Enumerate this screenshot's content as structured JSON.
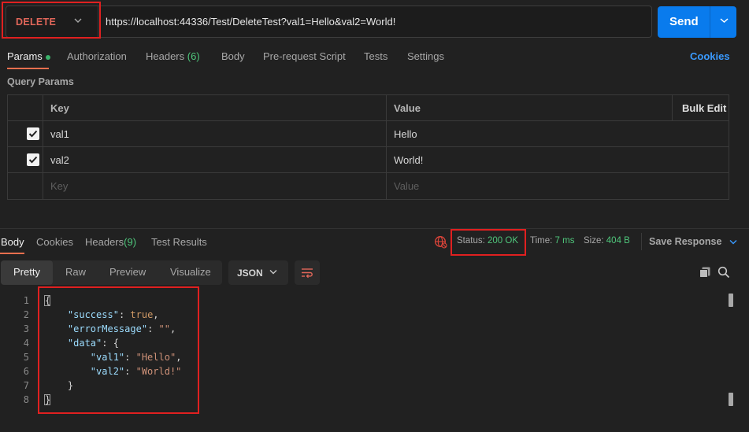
{
  "request": {
    "method": "DELETE",
    "url": "https://localhost:44336/Test/DeleteTest?val1=Hello&val2=World!",
    "send_label": "Send"
  },
  "request_tabs": {
    "params": "Params",
    "authorization": "Authorization",
    "headers": "Headers",
    "headers_count": "(6)",
    "body": "Body",
    "prerequest": "Pre-request Script",
    "tests": "Tests",
    "settings": "Settings",
    "cookies": "Cookies"
  },
  "query_params": {
    "title": "Query Params",
    "headers": {
      "key": "Key",
      "value": "Value",
      "bulk_edit": "Bulk Edit"
    },
    "rows": [
      {
        "key": "val1",
        "value": "Hello",
        "checked": true
      },
      {
        "key": "val2",
        "value": "World!",
        "checked": true
      }
    ],
    "placeholder": {
      "key": "Key",
      "value": "Value"
    }
  },
  "response_tabs": {
    "body": "Body",
    "cookies": "Cookies",
    "headers": "Headers",
    "headers_count": "(9)",
    "test_results": "Test Results"
  },
  "response_meta": {
    "status_label": "Status:",
    "status_value": "200 OK",
    "time_label": "Time:",
    "time_value": "7 ms",
    "size_label": "Size:",
    "size_value": "404 B",
    "save_response": "Save Response"
  },
  "response_view": {
    "modes": [
      "Pretty",
      "Raw",
      "Preview",
      "Visualize"
    ],
    "active_mode": "Pretty",
    "format": "JSON"
  },
  "response_body_lines": [
    {
      "n": "1",
      "parts": [
        [
          "p",
          "{"
        ]
      ]
    },
    {
      "n": "2",
      "parts": [
        [
          "p",
          "    "
        ],
        [
          "k",
          "\"success\""
        ],
        [
          "p",
          ": "
        ],
        [
          "b",
          "true"
        ],
        [
          "p",
          ","
        ]
      ]
    },
    {
      "n": "3",
      "parts": [
        [
          "p",
          "    "
        ],
        [
          "k",
          "\"errorMessage\""
        ],
        [
          "p",
          ": "
        ],
        [
          "s",
          "\"\""
        ],
        [
          "p",
          ","
        ]
      ]
    },
    {
      "n": "4",
      "parts": [
        [
          "p",
          "    "
        ],
        [
          "k",
          "\"data\""
        ],
        [
          "p",
          ": {"
        ]
      ]
    },
    {
      "n": "5",
      "parts": [
        [
          "p",
          "        "
        ],
        [
          "k",
          "\"val1\""
        ],
        [
          "p",
          ": "
        ],
        [
          "s",
          "\"Hello\""
        ],
        [
          "p",
          ","
        ]
      ]
    },
    {
      "n": "6",
      "parts": [
        [
          "p",
          "        "
        ],
        [
          "k",
          "\"val2\""
        ],
        [
          "p",
          ": "
        ],
        [
          "s",
          "\"World!\""
        ]
      ]
    },
    {
      "n": "7",
      "parts": [
        [
          "p",
          "    }"
        ]
      ]
    },
    {
      "n": "8",
      "parts": [
        [
          "p",
          "}"
        ]
      ]
    }
  ],
  "colors": {
    "method": "#e2675a",
    "send": "#097bed",
    "status_ok": "#4fc67b",
    "annotation": "#e02020"
  }
}
